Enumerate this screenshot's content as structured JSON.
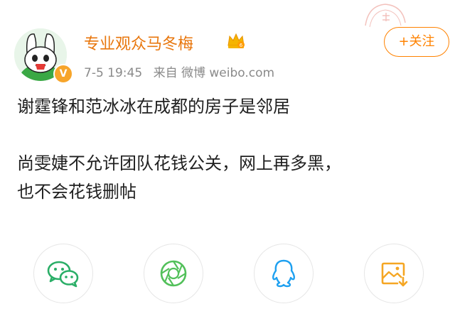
{
  "header": {
    "username": "专业观众马冬梅",
    "follow_label": "+关注",
    "verified_mark": "V",
    "crown_icon": "crown-icon",
    "meta": {
      "date": "7-5 19:45",
      "source": "来自 微博 weibo.com"
    }
  },
  "post": {
    "line1": "谢霆锋和范冰冰在成都的房子是邻居",
    "line2": "尚雯婕不允许团队花钱公关，网上再多黑，",
    "line3": "也不会花钱删帖"
  },
  "share_icons": [
    "wechat-icon",
    "moments-icon",
    "qq-icon",
    "save-image-icon"
  ],
  "colors": {
    "username": "#e8760c",
    "follow": "#ff8200",
    "meta": "#8a8a8a",
    "wechat": "#2aae67",
    "moments": "#52c05a",
    "qq": "#1ea0f0",
    "save": "#f5a623"
  }
}
